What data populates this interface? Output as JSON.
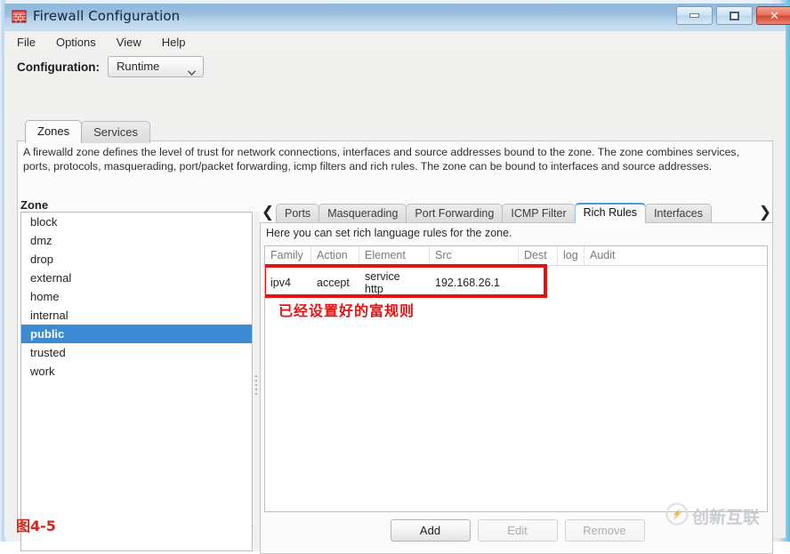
{
  "window": {
    "title": "Firewall Configuration",
    "app_icon": "firewall-brick-icon",
    "buttons": {
      "minimize": "minimize-icon",
      "maximize": "maximize-icon",
      "close": "✕"
    }
  },
  "menubar": {
    "items": [
      {
        "label": "File"
      },
      {
        "label": "Options"
      },
      {
        "label": "View"
      },
      {
        "label": "Help"
      }
    ]
  },
  "config": {
    "label": "Configuration:",
    "value": "Runtime",
    "arrow": "chevron-down-icon"
  },
  "top_tabs": [
    {
      "label": "Zones",
      "active": true
    },
    {
      "label": "Services",
      "active": false
    }
  ],
  "zone_description": "A firewalld zone defines the level of trust for network connections, interfaces and source addresses bound to the zone. The zone combines services, ports, protocols, masquerading, port/packet forwarding, icmp filters and rich rules. The zone can be bound to interfaces and source addresses.",
  "zone_panel": {
    "column_header": "Zone",
    "items": [
      {
        "label": "block",
        "selected": false
      },
      {
        "label": "dmz",
        "selected": false
      },
      {
        "label": "drop",
        "selected": false
      },
      {
        "label": "external",
        "selected": false
      },
      {
        "label": "home",
        "selected": false
      },
      {
        "label": "internal",
        "selected": false
      },
      {
        "label": "public",
        "selected": true
      },
      {
        "label": "trusted",
        "selected": false
      },
      {
        "label": "work",
        "selected": false
      }
    ],
    "selected_value": "public"
  },
  "right_panel": {
    "scroll_left_icon": "❮",
    "scroll_right_icon": "❯",
    "tabs": [
      {
        "label": "Ports",
        "active": false
      },
      {
        "label": "Masquerading",
        "active": false
      },
      {
        "label": "Port Forwarding",
        "active": false
      },
      {
        "label": "ICMP Filter",
        "active": false
      },
      {
        "label": "Rich Rules",
        "active": true
      },
      {
        "label": "Interfaces",
        "active": false
      }
    ],
    "hint": "Here you can set rich language rules for the zone.",
    "table": {
      "columns": [
        "Family",
        "Action",
        "Element",
        "Src",
        "Dest",
        "log",
        "Audit"
      ],
      "rows": [
        {
          "Family": "ipv4",
          "Action": "accept",
          "Element": "service\nhttp",
          "Src": "192.168.26.1",
          "Dest": "",
          "log": "",
          "Audit": ""
        }
      ]
    },
    "buttons": [
      {
        "label": "Add",
        "enabled": true
      },
      {
        "label": "Edit",
        "enabled": false
      },
      {
        "label": "Remove",
        "enabled": false
      }
    ]
  },
  "annotations": {
    "rule_note": "已经设置好的富规则",
    "figure_caption": "图4-5",
    "highlight_color": "#e8110f",
    "note_color": "#e8110f",
    "caption_color": "#d9251c"
  },
  "watermark": {
    "text": "创新互联",
    "logo_icon": "cx-logo-icon"
  }
}
